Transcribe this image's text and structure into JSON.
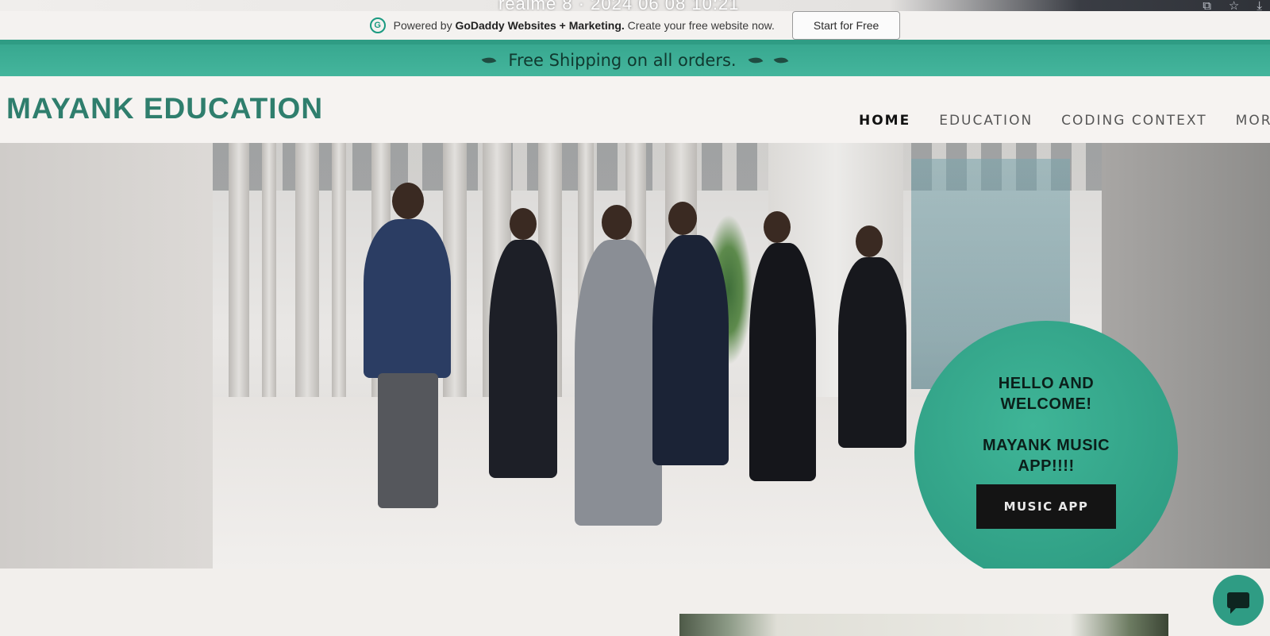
{
  "watermark": "realme 8 · 2024 06 08 10:21",
  "browser": {
    "icons": [
      "extension-icon",
      "star-icon",
      "download-icon"
    ]
  },
  "powered_bar": {
    "prefix": "Powered by",
    "brand": "GoDaddy Websites + Marketing.",
    "suffix": "Create your free website now.",
    "start_button": "Start for Free"
  },
  "shipping": {
    "text": "Free Shipping on all orders."
  },
  "header": {
    "brand": "MAYANK EDUCATION",
    "nav": [
      {
        "label": "HOME",
        "active": true
      },
      {
        "label": "EDUCATION",
        "active": false
      },
      {
        "label": "CODING CONTEXT",
        "active": false
      },
      {
        "label": "MORE",
        "active": false
      }
    ]
  },
  "hero": {
    "welcome_line1": "HELLO AND",
    "welcome_line2": "WELCOME!",
    "welcome_line3": "MAYANK MUSIC",
    "welcome_line4": "APP!!!!",
    "button": "MUSIC APP"
  },
  "colors": {
    "accent": "#2f9c84",
    "brand_text": "#2f7e6d",
    "button_dark": "#141414"
  }
}
